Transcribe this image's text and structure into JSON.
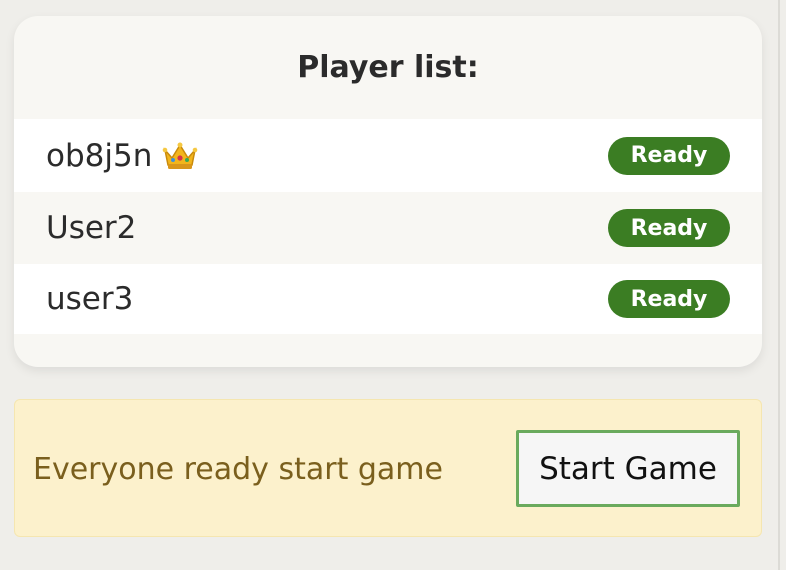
{
  "player_list": {
    "title": "Player list:",
    "players": [
      {
        "name": "ob8j5n",
        "is_host": true,
        "host_icon": "crown-icon",
        "status": "Ready"
      },
      {
        "name": "User2",
        "is_host": false,
        "status": "Ready"
      },
      {
        "name": "user3",
        "is_host": false,
        "status": "Ready"
      }
    ]
  },
  "ready_banner": {
    "message": "Everyone ready start game",
    "start_button_label": "Start Game"
  },
  "colors": {
    "ready_badge": "#3b7d23",
    "banner_bg": "#fcf1cc",
    "banner_text": "#7a5f1d",
    "button_border": "#6aaa5d"
  }
}
